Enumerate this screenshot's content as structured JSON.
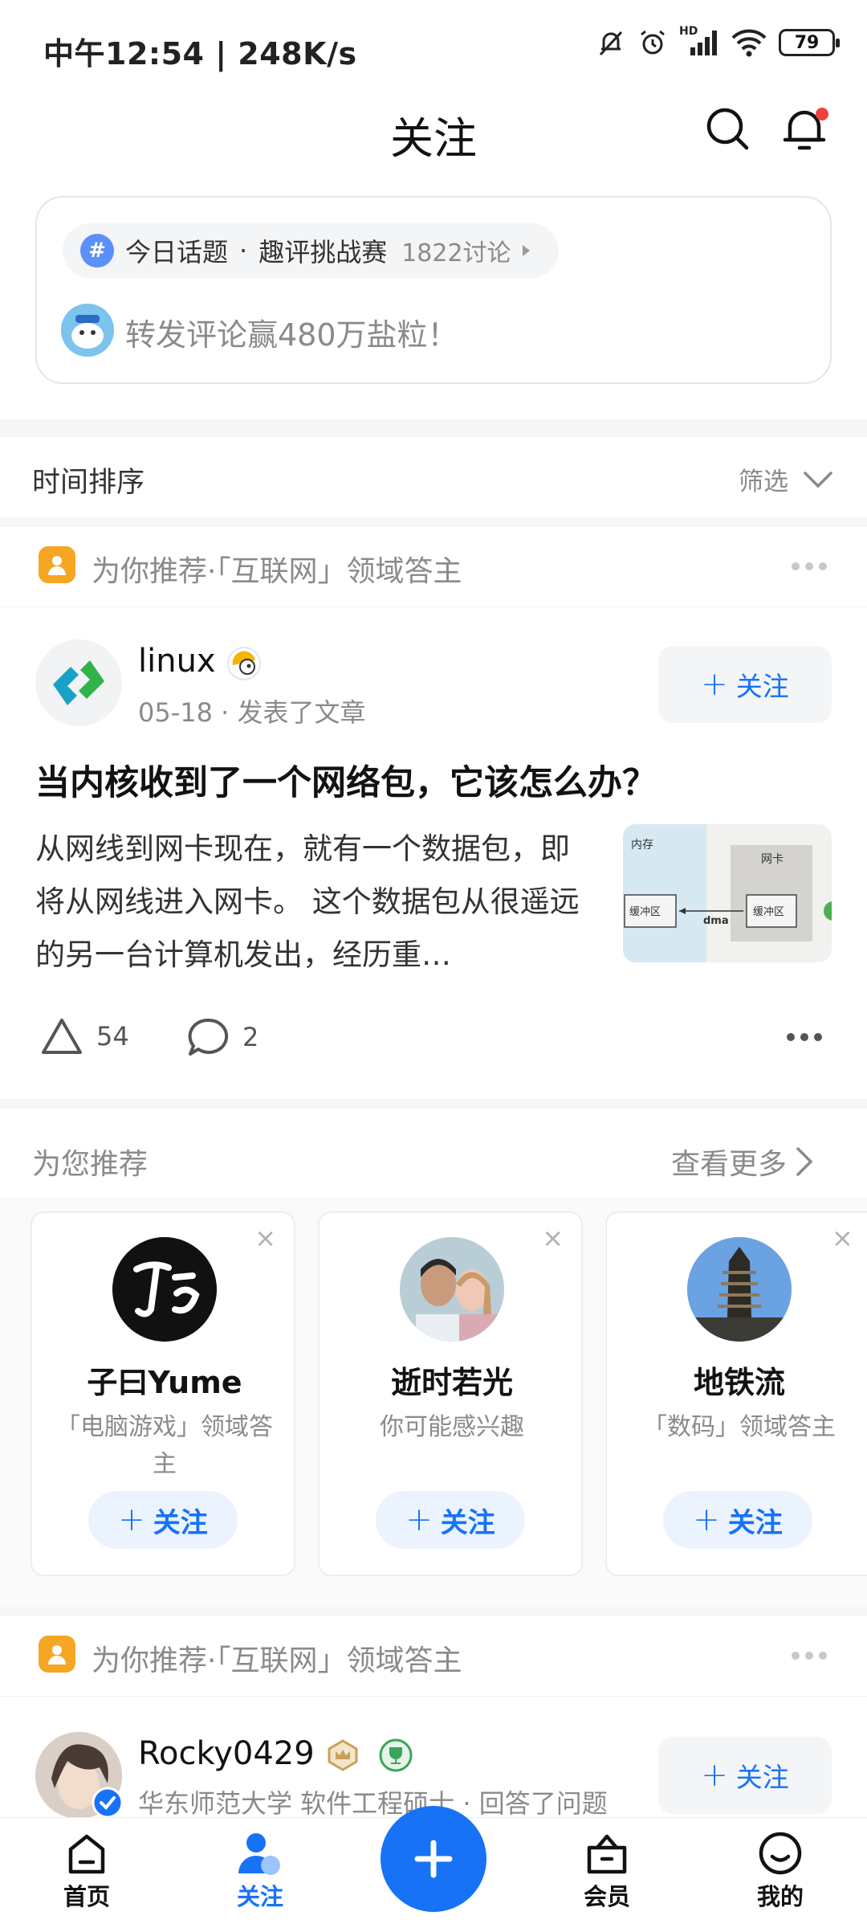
{
  "status_bar": {
    "time": "中午12:54 | 248K/s",
    "battery": "79",
    "hd": "HD"
  },
  "header": {
    "title": "关注"
  },
  "topic": {
    "label": "今日话题",
    "separator": "·",
    "name": "趣评挑战赛",
    "count": "1822讨论",
    "promo": "转发评论赢480万盐粒！"
  },
  "sort": {
    "label": "时间排序",
    "filter": "筛选"
  },
  "recommend_header_1": {
    "text": "为你推荐·「互联网」领域答主"
  },
  "post": {
    "author": "linux",
    "meta": "05-18 · 发表了文章",
    "follow": "关注",
    "title": "当内核收到了一个网络包，它该怎么办？",
    "excerpt": "从网线到网卡现在，就有一个数据包，即将从网线进入网卡。 这个数据包从很遥远的另一台计算机发出，经历重…",
    "thumb": {
      "mem": "内存",
      "nic": "网卡",
      "buf": "缓冲区",
      "dma": "dma"
    },
    "likes": "54",
    "comments": "2"
  },
  "suggestions": {
    "title": "为您推荐",
    "more": "查看更多",
    "cards": [
      {
        "name": "子曰Yume",
        "desc": "「电脑游戏」领域答主",
        "follow": "关注"
      },
      {
        "name": "逝时若光",
        "desc": "你可能感兴趣",
        "follow": "关注"
      },
      {
        "name": "地铁流",
        "desc": "「数码」领域答主",
        "follow": "关注"
      }
    ]
  },
  "recommend_header_2": {
    "text": "为你推荐·「互联网」领域答主"
  },
  "post2": {
    "author": "Rocky0429",
    "meta": "华东师范大学 软件工程硕士 · 回答了问题",
    "follow": "关注"
  },
  "nav": {
    "home": "首页",
    "follow": "关注",
    "vip": "会员",
    "mine": "我的"
  },
  "colors": {
    "accent": "#1772f6",
    "badge": "#f1403c",
    "recommend": "#f5a623"
  }
}
